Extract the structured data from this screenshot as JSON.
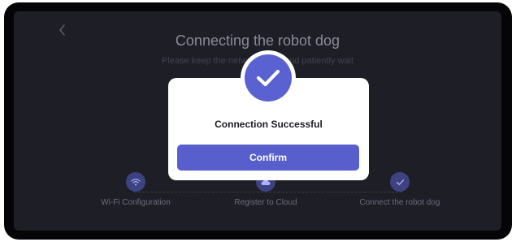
{
  "header": {
    "back_icon": "chevron-left-icon",
    "title": "Connecting the robot dog",
    "subtitle": "Please keep the network open and patiently wait"
  },
  "steps": [
    {
      "label": "Wi-Fi Configuration",
      "icon": "wifi-icon"
    },
    {
      "label": "Register to Cloud",
      "icon": "cloud-icon"
    },
    {
      "label": "Connect the robot dog",
      "icon": "check-icon"
    }
  ],
  "dialog": {
    "icon": "success-check-icon",
    "message": "Connection Successful",
    "confirm_label": "Confirm"
  },
  "colors": {
    "accent": "#585fcc",
    "background": "#1d1e26"
  }
}
